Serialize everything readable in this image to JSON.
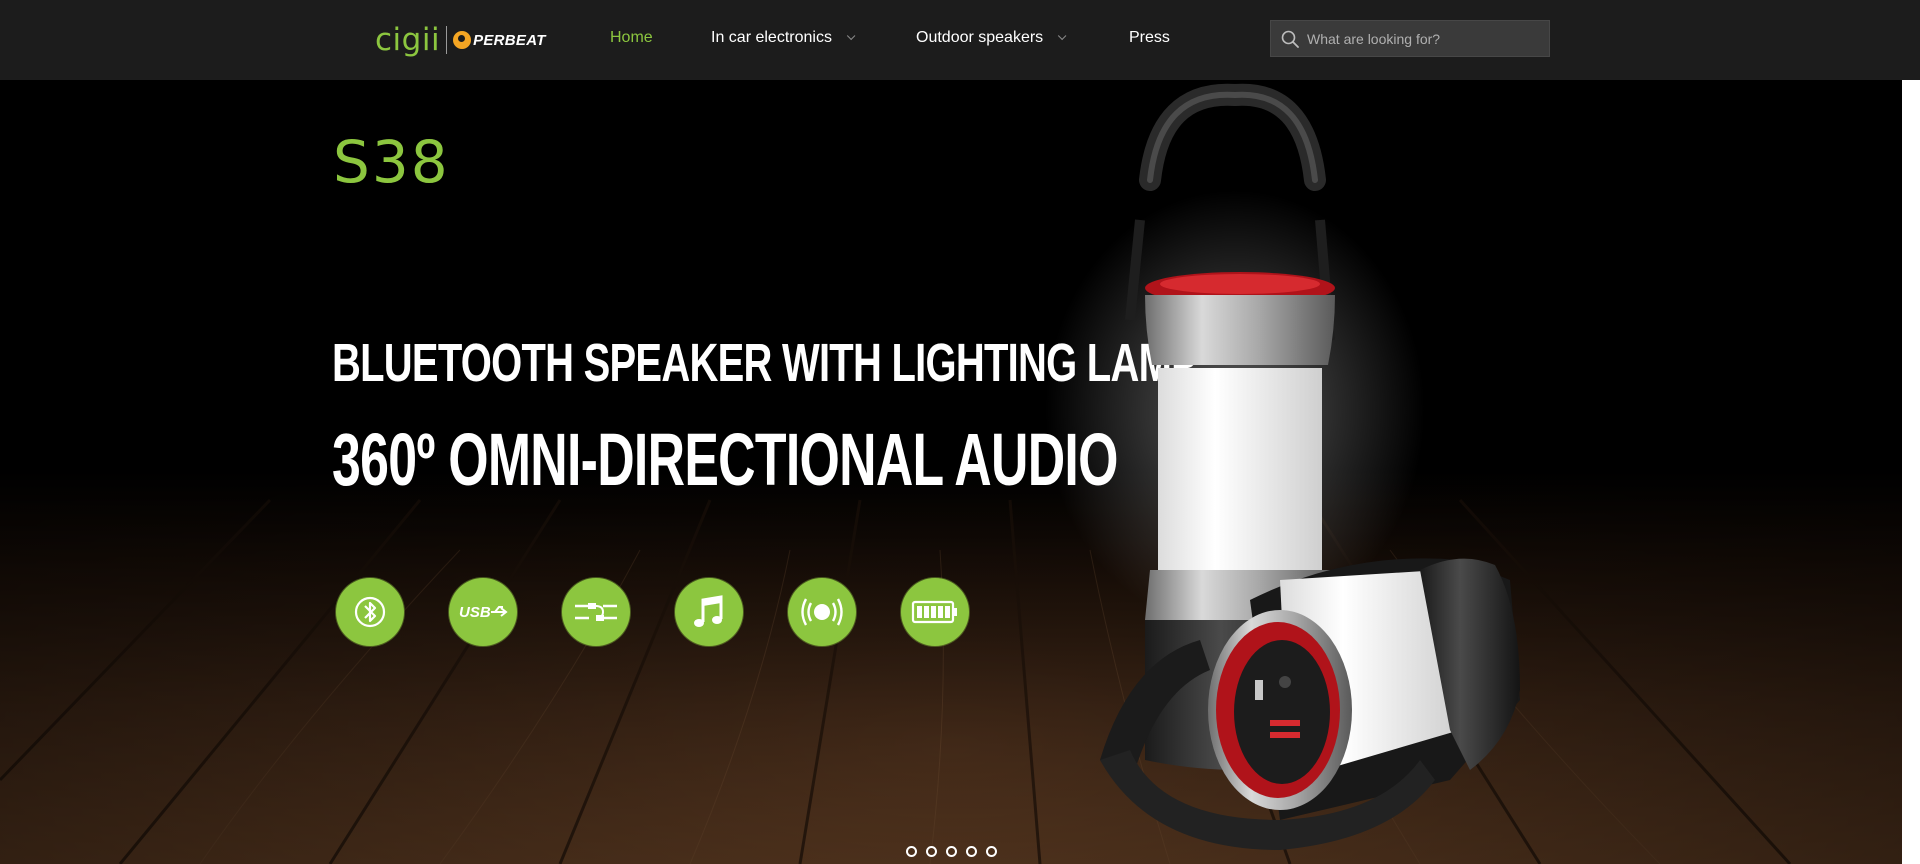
{
  "header": {
    "logo": {
      "brand_1": "cigii",
      "brand_2": "PERBEAT"
    },
    "nav": [
      {
        "label": "Home",
        "active": true,
        "has_dropdown": false
      },
      {
        "label": "In car electronics",
        "active": false,
        "has_dropdown": true
      },
      {
        "label": "Outdoor speakers",
        "active": false,
        "has_dropdown": true
      },
      {
        "label": "Press",
        "active": false,
        "has_dropdown": false
      }
    ],
    "search": {
      "placeholder": "What are looking for?",
      "value": ""
    }
  },
  "hero": {
    "model": "S38",
    "headline_1": "BLUETOOTH SPEAKER WITH LIGHTING LAMP,",
    "headline_2": "360º OMNI-DIRECTIONAL AUDIO",
    "feature_icons": [
      "bluetooth-icon",
      "usb-icon",
      "aux-cable-icon",
      "music-note-icon",
      "speaker-sound-icon",
      "battery-icon"
    ],
    "feature_usb_text": "USB",
    "slides": {
      "count": 5,
      "active_index": 0
    }
  },
  "colors": {
    "accent": "#8cc63f",
    "header_bg": "#1c1c1c",
    "text": "#ffffff"
  }
}
